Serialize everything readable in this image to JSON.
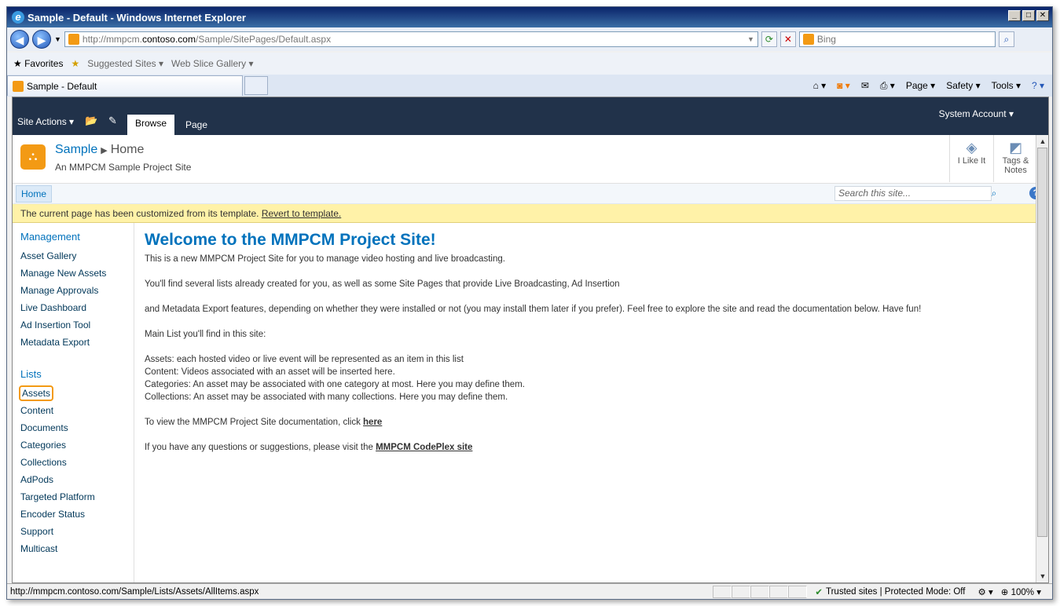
{
  "window": {
    "title": "Sample - Default - Windows Internet Explorer"
  },
  "address": {
    "url_prefix": "http://mmpcm.",
    "url_host": "contoso.com",
    "url_rest": "/Sample/SitePages/Default.aspx"
  },
  "search_box": {
    "placeholder": "Bing"
  },
  "favbar": {
    "favorites": "Favorites",
    "suggested": "Suggested Sites",
    "webslice": "Web Slice Gallery"
  },
  "tab": {
    "label": "Sample - Default"
  },
  "cmdbar": {
    "page": "Page",
    "safety": "Safety",
    "tools": "Tools"
  },
  "ribbon": {
    "site_actions": "Site Actions",
    "browse": "Browse",
    "page": "Page",
    "account": "System Account"
  },
  "site": {
    "title": "Sample",
    "current": "Home",
    "subtitle": "An MMPCM Sample Project Site",
    "like": "I Like It",
    "tags_line1": "Tags &",
    "tags_line2": "Notes"
  },
  "topnav": {
    "home": "Home",
    "search_placeholder": "Search this site..."
  },
  "notice": {
    "text": "The current page has been customized from its template.",
    "link": "Revert to template."
  },
  "leftnav": {
    "management_head": "Management",
    "management": [
      "Asset Gallery",
      "Manage New Assets",
      "Manage Approvals",
      "Live Dashboard",
      "Ad Insertion Tool",
      "Metadata Export"
    ],
    "lists_head": "Lists",
    "lists": [
      "Assets",
      "Content",
      "Documents",
      "Categories",
      "Collections",
      "AdPods",
      "Targeted Platform",
      "Encoder Status",
      "Support",
      "Multicast"
    ]
  },
  "main": {
    "heading": "Welcome to the MMPCM Project Site!",
    "p1": "This is a new MMPCM Project Site for you to manage video hosting and live broadcasting.",
    "p2": "You'll find several lists already created for you, as well as some Site Pages that provide Live Broadcasting, Ad Insertion",
    "p3": "and Metadata Export features, depending on whether they were installed or not (you may install them later if you prefer). Feel free to explore the site and read the documentation below. Have fun!",
    "p4": "Main List you'll find in this site:",
    "l1": "Assets: each hosted video or live event will be represented as an item in this list",
    "l2": "Content: Videos associated with an asset will be inserted here.",
    "l3": "Categories: An asset may be associated with one category at most. Here you may define them.",
    "l4": "Collections: An asset may be associated with many collections. Here you may define them.",
    "doc_text": "To view the MMPCM Project Site documentation, click",
    "doc_link": "here",
    "q_text": "If you have any questions or suggestions, please visit the",
    "q_link": "MMPCM CodePlex site"
  },
  "status": {
    "url": "http://mmpcm.contoso.com/Sample/Lists/Assets/AllItems.aspx",
    "zone": "Trusted sites | Protected Mode: Off",
    "zoom": "100%"
  }
}
